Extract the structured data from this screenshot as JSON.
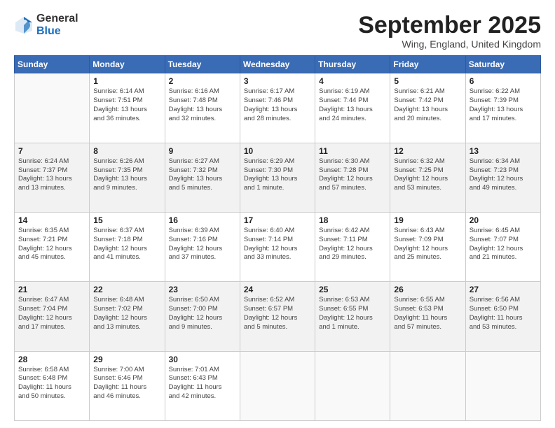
{
  "logo": {
    "general": "General",
    "blue": "Blue"
  },
  "header": {
    "month": "September 2025",
    "location": "Wing, England, United Kingdom"
  },
  "weekdays": [
    "Sunday",
    "Monday",
    "Tuesday",
    "Wednesday",
    "Thursday",
    "Friday",
    "Saturday"
  ],
  "weeks": [
    {
      "shaded": false,
      "days": [
        {
          "num": "",
          "info": ""
        },
        {
          "num": "1",
          "info": "Sunrise: 6:14 AM\nSunset: 7:51 PM\nDaylight: 13 hours\nand 36 minutes."
        },
        {
          "num": "2",
          "info": "Sunrise: 6:16 AM\nSunset: 7:48 PM\nDaylight: 13 hours\nand 32 minutes."
        },
        {
          "num": "3",
          "info": "Sunrise: 6:17 AM\nSunset: 7:46 PM\nDaylight: 13 hours\nand 28 minutes."
        },
        {
          "num": "4",
          "info": "Sunrise: 6:19 AM\nSunset: 7:44 PM\nDaylight: 13 hours\nand 24 minutes."
        },
        {
          "num": "5",
          "info": "Sunrise: 6:21 AM\nSunset: 7:42 PM\nDaylight: 13 hours\nand 20 minutes."
        },
        {
          "num": "6",
          "info": "Sunrise: 6:22 AM\nSunset: 7:39 PM\nDaylight: 13 hours\nand 17 minutes."
        }
      ]
    },
    {
      "shaded": true,
      "days": [
        {
          "num": "7",
          "info": "Sunrise: 6:24 AM\nSunset: 7:37 PM\nDaylight: 13 hours\nand 13 minutes."
        },
        {
          "num": "8",
          "info": "Sunrise: 6:26 AM\nSunset: 7:35 PM\nDaylight: 13 hours\nand 9 minutes."
        },
        {
          "num": "9",
          "info": "Sunrise: 6:27 AM\nSunset: 7:32 PM\nDaylight: 13 hours\nand 5 minutes."
        },
        {
          "num": "10",
          "info": "Sunrise: 6:29 AM\nSunset: 7:30 PM\nDaylight: 13 hours\nand 1 minute."
        },
        {
          "num": "11",
          "info": "Sunrise: 6:30 AM\nSunset: 7:28 PM\nDaylight: 12 hours\nand 57 minutes."
        },
        {
          "num": "12",
          "info": "Sunrise: 6:32 AM\nSunset: 7:25 PM\nDaylight: 12 hours\nand 53 minutes."
        },
        {
          "num": "13",
          "info": "Sunrise: 6:34 AM\nSunset: 7:23 PM\nDaylight: 12 hours\nand 49 minutes."
        }
      ]
    },
    {
      "shaded": false,
      "days": [
        {
          "num": "14",
          "info": "Sunrise: 6:35 AM\nSunset: 7:21 PM\nDaylight: 12 hours\nand 45 minutes."
        },
        {
          "num": "15",
          "info": "Sunrise: 6:37 AM\nSunset: 7:18 PM\nDaylight: 12 hours\nand 41 minutes."
        },
        {
          "num": "16",
          "info": "Sunrise: 6:39 AM\nSunset: 7:16 PM\nDaylight: 12 hours\nand 37 minutes."
        },
        {
          "num": "17",
          "info": "Sunrise: 6:40 AM\nSunset: 7:14 PM\nDaylight: 12 hours\nand 33 minutes."
        },
        {
          "num": "18",
          "info": "Sunrise: 6:42 AM\nSunset: 7:11 PM\nDaylight: 12 hours\nand 29 minutes."
        },
        {
          "num": "19",
          "info": "Sunrise: 6:43 AM\nSunset: 7:09 PM\nDaylight: 12 hours\nand 25 minutes."
        },
        {
          "num": "20",
          "info": "Sunrise: 6:45 AM\nSunset: 7:07 PM\nDaylight: 12 hours\nand 21 minutes."
        }
      ]
    },
    {
      "shaded": true,
      "days": [
        {
          "num": "21",
          "info": "Sunrise: 6:47 AM\nSunset: 7:04 PM\nDaylight: 12 hours\nand 17 minutes."
        },
        {
          "num": "22",
          "info": "Sunrise: 6:48 AM\nSunset: 7:02 PM\nDaylight: 12 hours\nand 13 minutes."
        },
        {
          "num": "23",
          "info": "Sunrise: 6:50 AM\nSunset: 7:00 PM\nDaylight: 12 hours\nand 9 minutes."
        },
        {
          "num": "24",
          "info": "Sunrise: 6:52 AM\nSunset: 6:57 PM\nDaylight: 12 hours\nand 5 minutes."
        },
        {
          "num": "25",
          "info": "Sunrise: 6:53 AM\nSunset: 6:55 PM\nDaylight: 12 hours\nand 1 minute."
        },
        {
          "num": "26",
          "info": "Sunrise: 6:55 AM\nSunset: 6:53 PM\nDaylight: 11 hours\nand 57 minutes."
        },
        {
          "num": "27",
          "info": "Sunrise: 6:56 AM\nSunset: 6:50 PM\nDaylight: 11 hours\nand 53 minutes."
        }
      ]
    },
    {
      "shaded": false,
      "days": [
        {
          "num": "28",
          "info": "Sunrise: 6:58 AM\nSunset: 6:48 PM\nDaylight: 11 hours\nand 50 minutes."
        },
        {
          "num": "29",
          "info": "Sunrise: 7:00 AM\nSunset: 6:46 PM\nDaylight: 11 hours\nand 46 minutes."
        },
        {
          "num": "30",
          "info": "Sunrise: 7:01 AM\nSunset: 6:43 PM\nDaylight: 11 hours\nand 42 minutes."
        },
        {
          "num": "",
          "info": ""
        },
        {
          "num": "",
          "info": ""
        },
        {
          "num": "",
          "info": ""
        },
        {
          "num": "",
          "info": ""
        }
      ]
    }
  ]
}
